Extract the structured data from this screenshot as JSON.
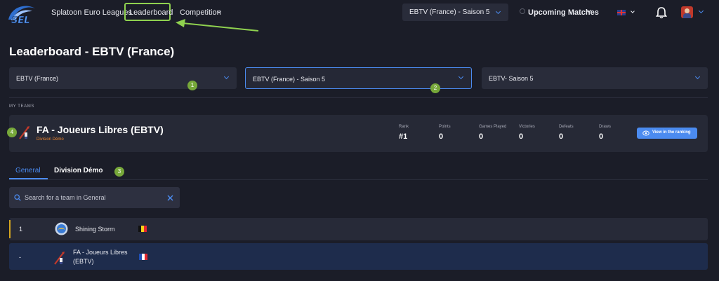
{
  "nav": {
    "brand": "Splatoon Euro Leagues",
    "leaderboard": "Leaderboard",
    "competition": "Competition",
    "season_select": "EBTV (France) - Saison 5",
    "upcoming_matches": "Upcoming Matches",
    "annotation_color": "#8fd14f"
  },
  "page": {
    "title": "Leaderboard - EBTV (France)"
  },
  "filters": [
    {
      "value": "EBTV (France)",
      "marker": "1"
    },
    {
      "value": "EBTV (France) - Saison 5",
      "marker": "2"
    },
    {
      "value": "EBTV- Saison 5"
    }
  ],
  "my_teams": {
    "section_label": "MY TEAMS",
    "marker": "4",
    "team": {
      "name": "FA - Joueurs Libres (EBTV)",
      "division": "Division Démo",
      "stats": [
        {
          "label": "Rank",
          "value": "#1"
        },
        {
          "label": "Points",
          "value": "0"
        },
        {
          "label": "Games Played",
          "value": "0"
        },
        {
          "label": "Victories",
          "value": "0"
        },
        {
          "label": "Defeats",
          "value": "0"
        },
        {
          "label": "Draws",
          "value": "0"
        }
      ],
      "view_button": "View in the ranking"
    }
  },
  "tabs": {
    "items": [
      "General",
      "Division Démo"
    ],
    "active": "General",
    "marker": "3"
  },
  "search": {
    "placeholder": "Search for a team in General"
  },
  "ranking": [
    {
      "rank": "1",
      "team": "Shining Storm",
      "flag": "belgium"
    },
    {
      "rank": "-",
      "team_line1": "FA - Joueurs Libres",
      "team_line2": "(EBTV)",
      "flag": "france"
    }
  ],
  "colors": {
    "accent": "#4b8bf0",
    "division": "#f0862e",
    "first_place": "#d4a51f",
    "marker": "#77a83a"
  }
}
